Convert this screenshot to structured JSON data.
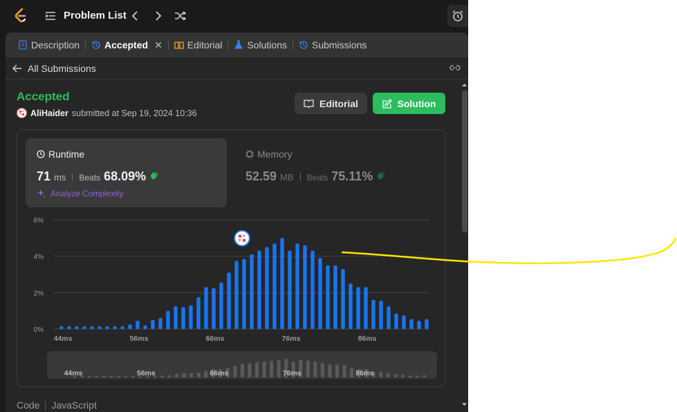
{
  "topbar": {
    "title": "Problem List"
  },
  "tabs": [
    {
      "label": "Description",
      "icon": "description-icon",
      "active": false
    },
    {
      "label": "Accepted",
      "icon": "history-icon",
      "active": true
    },
    {
      "label": "Editorial",
      "icon": "book-icon",
      "active": false
    },
    {
      "label": "Solutions",
      "icon": "flask-icon",
      "active": false
    },
    {
      "label": "Submissions",
      "icon": "history-icon",
      "active": false
    }
  ],
  "subbar": {
    "back_label": "All Submissions"
  },
  "submission": {
    "status": "Accepted",
    "user": "AliHaider",
    "submitted_text": "submitted at Sep 19, 2024 10:36"
  },
  "buttons": {
    "editorial": "Editorial",
    "solution": "Solution"
  },
  "runtime": {
    "title": "Runtime",
    "value": "71",
    "unit": "ms",
    "beats_label": "Beats",
    "beats": "68.09%",
    "analyze": "Analyze Complexity"
  },
  "memory": {
    "title": "Memory",
    "value": "52.59",
    "unit": "MB",
    "beats_label": "Beats",
    "beats": "75.11%"
  },
  "chart_data": {
    "type": "bar",
    "title": "",
    "xlabel": "",
    "ylabel": "",
    "x_tick_labels": [
      "44ms",
      "56ms",
      "66ms",
      "76ms",
      "86ms"
    ],
    "y_tick_labels": [
      "6%",
      "4%",
      "2%",
      "0%"
    ],
    "ylim": [
      0,
      6
    ],
    "grid": true,
    "values": [
      0.15,
      0.15,
      0.15,
      0.15,
      0.15,
      0.15,
      0.15,
      0.15,
      0.15,
      0.25,
      0.45,
      0.2,
      0.5,
      0.6,
      1.0,
      1.25,
      1.2,
      1.3,
      1.75,
      2.3,
      2.25,
      2.55,
      3.1,
      3.75,
      3.85,
      4.1,
      4.3,
      4.5,
      4.7,
      5.0,
      4.3,
      4.7,
      4.6,
      4.3,
      3.9,
      3.5,
      3.5,
      3.3,
      2.5,
      2.3,
      2.3,
      1.6,
      1.55,
      1.25,
      0.85,
      0.75,
      0.55,
      0.45,
      0.55
    ],
    "highlight_index": 24,
    "color": "#1a74ef"
  },
  "mini_chart": {
    "x_tick_labels": [
      "44ms",
      "56ms",
      "66ms",
      "76ms",
      "86ms"
    ]
  },
  "footer": {
    "code_label": "Code",
    "language": "JavaScript"
  },
  "colors": {
    "accepted": "#2cbb5d",
    "bar": "#1a74ef",
    "analyze": "#8e62e0",
    "annotation": "#ffe600"
  }
}
